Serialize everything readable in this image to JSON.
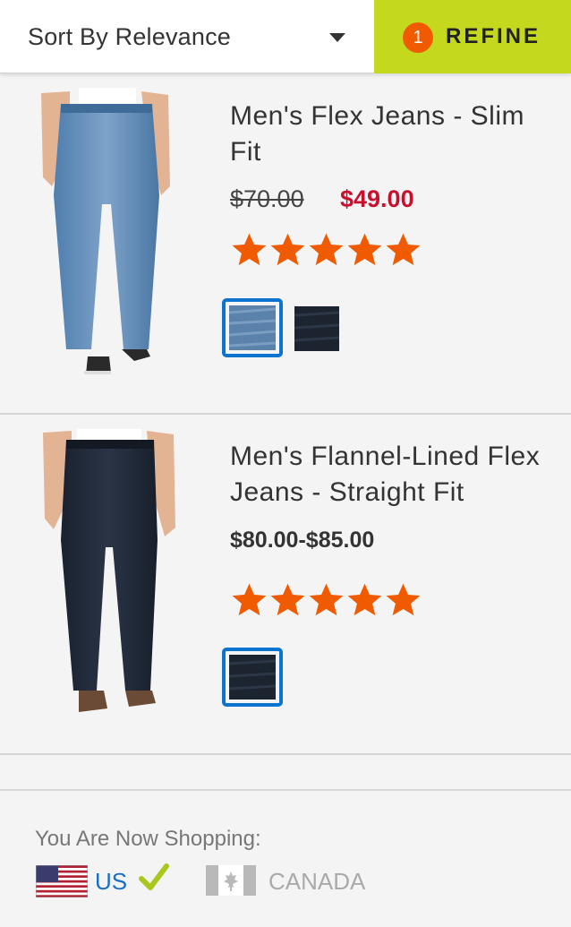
{
  "toolbar": {
    "sort_label": "Sort By Relevance",
    "refine_count": "1",
    "refine_label": "REFINE"
  },
  "products": [
    {
      "name": "Men's Flex Jeans - Slim Fit",
      "price_original": "$70.00",
      "price_sale": "$49.00",
      "rating": 5,
      "swatches": [
        "light-indigo",
        "dark-rinse"
      ],
      "selected_swatch": 0
    },
    {
      "name": "Men's Flannel-Lined Flex Jeans - Straight Fit",
      "price_range": "$80.00-$85.00",
      "rating": 5,
      "swatches": [
        "dark-rinse"
      ],
      "selected_swatch": 0
    }
  ],
  "footer": {
    "shopping_label": "You Are Now Shopping:",
    "country_us": "US",
    "country_canada": "CANADA"
  },
  "colors": {
    "refine_bg": "#c4d81e",
    "badge": "#f05a00",
    "sale_price": "#c8102e",
    "star": "#f05a00",
    "swatch_selected": "#0b74d1",
    "link": "#1a6fc4",
    "check": "#a8c81e"
  }
}
